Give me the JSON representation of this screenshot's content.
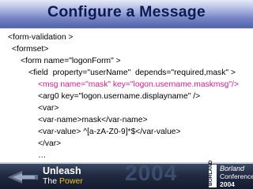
{
  "slide": {
    "title": "Configure a Message",
    "code_lines": [
      "<form-validation >",
      "<formset>",
      "<form name=\"logonForm\" >",
      "<field  property=\"userName\"  depends=\"required,mask\" >",
      "<msg name=\"mask\" key=\"logon.username.maskmsg\"/>",
      "<arg0 key=\"logon.username.displayname\" />",
      "<var>",
      "<var-name>mask</var-name>",
      "<var-value> ^[a-zA-Z0-9]*$</var-value>",
      "</var>",
      "…"
    ],
    "highlight_color": "#cc1f8e"
  },
  "footer": {
    "tagline_line1": "Unleash",
    "tagline_the": "The",
    "tagline_power": "Power",
    "year_watermark": "2004",
    "borland_side_text": "BORLAND",
    "brand": "Borland",
    "conference": "Conference",
    "conference_year": "2004"
  }
}
